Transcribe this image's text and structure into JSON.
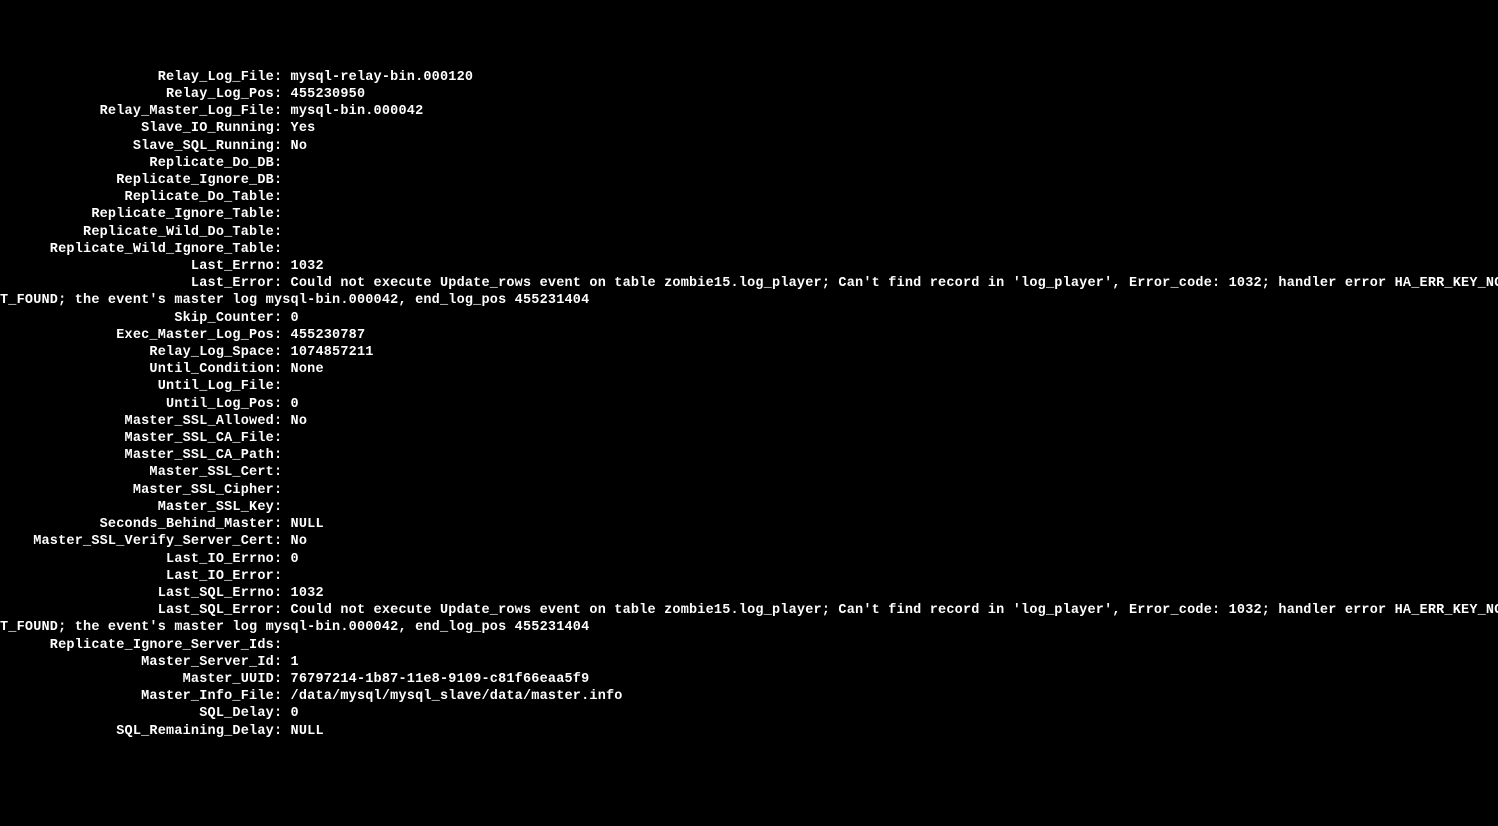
{
  "label_pad": 33,
  "lines": [
    {
      "label": "Relay_Log_File",
      "value": "mysql-relay-bin.000120"
    },
    {
      "label": "Relay_Log_Pos",
      "value": "455230950"
    },
    {
      "label": "Relay_Master_Log_File",
      "value": "mysql-bin.000042"
    },
    {
      "label": "Slave_IO_Running",
      "value": "Yes"
    },
    {
      "label": "Slave_SQL_Running",
      "value": "No"
    },
    {
      "label": "Replicate_Do_DB",
      "value": ""
    },
    {
      "label": "Replicate_Ignore_DB",
      "value": ""
    },
    {
      "label": "Replicate_Do_Table",
      "value": ""
    },
    {
      "label": "Replicate_Ignore_Table",
      "value": ""
    },
    {
      "label": "Replicate_Wild_Do_Table",
      "value": ""
    },
    {
      "label": "Replicate_Wild_Ignore_Table",
      "value": ""
    },
    {
      "label": "Last_Errno",
      "value": "1032"
    },
    {
      "label": "Last_Error",
      "value": "Could not execute Update_rows event on table zombie15.log_player; Can't find record in 'log_player', Error_code: 1032; handler error HA_ERR_KEY_NOT_FOUND; the event's master log mysql-bin.000042, end_log_pos 455231404",
      "wrap": true
    },
    {
      "label": "Skip_Counter",
      "value": "0"
    },
    {
      "label": "Exec_Master_Log_Pos",
      "value": "455230787"
    },
    {
      "label": "Relay_Log_Space",
      "value": "1074857211"
    },
    {
      "label": "Until_Condition",
      "value": "None"
    },
    {
      "label": "Until_Log_File",
      "value": ""
    },
    {
      "label": "Until_Log_Pos",
      "value": "0"
    },
    {
      "label": "Master_SSL_Allowed",
      "value": "No"
    },
    {
      "label": "Master_SSL_CA_File",
      "value": ""
    },
    {
      "label": "Master_SSL_CA_Path",
      "value": ""
    },
    {
      "label": "Master_SSL_Cert",
      "value": ""
    },
    {
      "label": "Master_SSL_Cipher",
      "value": ""
    },
    {
      "label": "Master_SSL_Key",
      "value": ""
    },
    {
      "label": "Seconds_Behind_Master",
      "value": "NULL"
    },
    {
      "label": "Master_SSL_Verify_Server_Cert",
      "value": "No"
    },
    {
      "label": "Last_IO_Errno",
      "value": "0"
    },
    {
      "label": "Last_IO_Error",
      "value": ""
    },
    {
      "label": "Last_SQL_Errno",
      "value": "1032"
    },
    {
      "label": "Last_SQL_Error",
      "value": "Could not execute Update_rows event on table zombie15.log_player; Can't find record in 'log_player', Error_code: 1032; handler error HA_ERR_KEY_NOT_FOUND; the event's master log mysql-bin.000042, end_log_pos 455231404",
      "wrap": true
    },
    {
      "label": "Replicate_Ignore_Server_Ids",
      "value": ""
    },
    {
      "label": "Master_Server_Id",
      "value": "1"
    },
    {
      "label": "Master_UUID",
      "value": "76797214-1b87-11e8-9109-c81f66eaa5f9"
    },
    {
      "label": "Master_Info_File",
      "value": "/data/mysql/mysql_slave/data/master.info"
    },
    {
      "label": "SQL_Delay",
      "value": "0"
    },
    {
      "label": "SQL_Remaining_Delay",
      "value": "NULL"
    }
  ],
  "wrap_prefix": "T_FOUND; the event's master log mysql-bin.000042, end_log_pos 455231404",
  "wrap_first_cut": 158,
  "screen_cols": 196
}
